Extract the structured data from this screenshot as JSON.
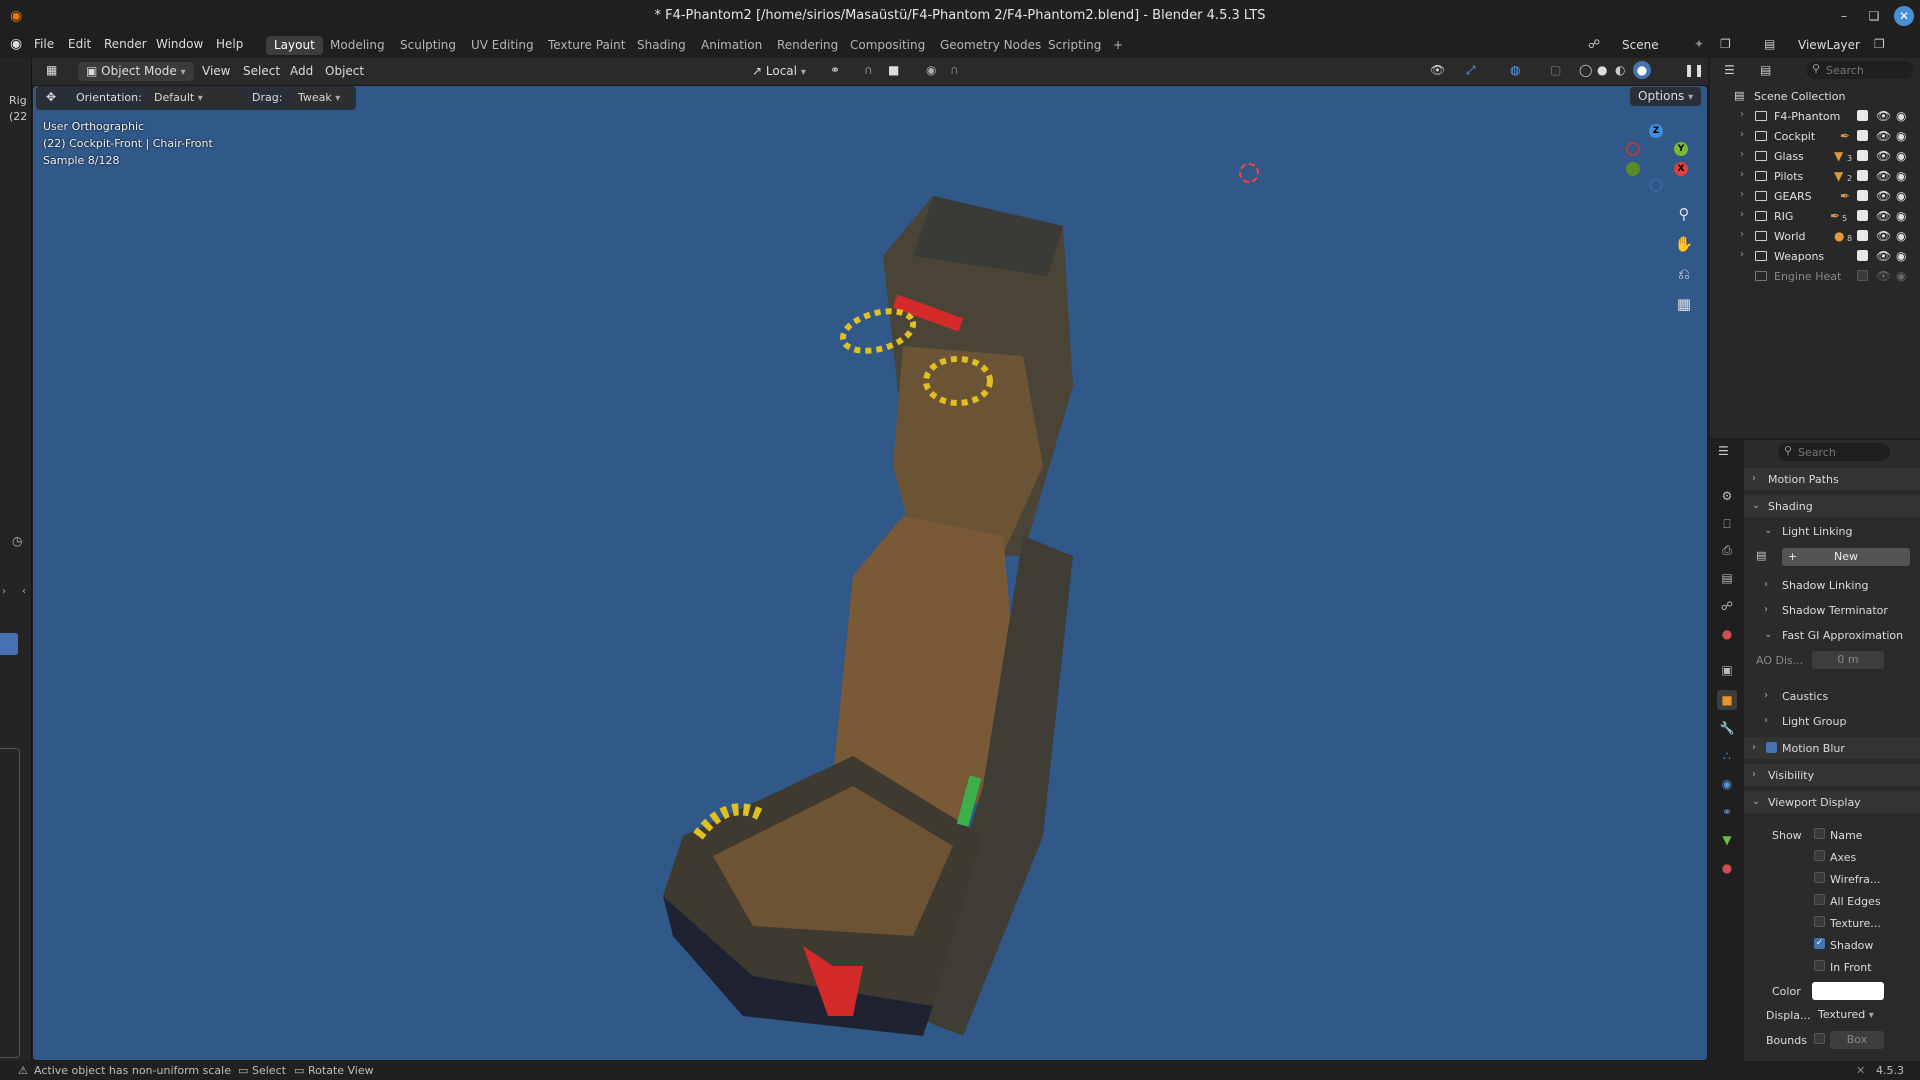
{
  "window": {
    "title": "* F4-Phantom2 [/home/sirios/Masaüstü/F4-Phantom 2/F4-Phantom2.blend] - Blender 4.5.3 LTS",
    "controls": [
      "minimize-icon",
      "maximize-icon",
      "close-icon"
    ]
  },
  "menu": {
    "items": [
      "File",
      "Edit",
      "Render",
      "Window",
      "Help"
    ]
  },
  "workspaces": {
    "tabs": [
      "Layout",
      "Modeling",
      "Sculpting",
      "UV Editing",
      "Texture Paint",
      "Shading",
      "Animation",
      "Rendering",
      "Compositing",
      "Geometry Nodes",
      "Scripting"
    ],
    "active": "Layout",
    "add_label": "+"
  },
  "scene": {
    "label": "Scene",
    "view_layer": "ViewLayer"
  },
  "viewport_header": {
    "mode": "Object Mode",
    "menus": [
      "View",
      "Select",
      "Add",
      "Object"
    ],
    "transform_orientation": "Local",
    "options_label": "Options"
  },
  "tool_settings": {
    "orientation_label": "Orientation:",
    "orientation_value": "Default",
    "drag_label": "Drag:",
    "drag_value": "Tweak"
  },
  "viewport_overlay": {
    "view_name": "User Orthographic",
    "object_info": "(22) Cockpit-Front | Chair-Front",
    "sample": "Sample 8/128"
  },
  "left_panel_fragments": {
    "text1": "Rig",
    "text2": "(22"
  },
  "gizmo": {
    "axes": [
      "Z",
      "Y",
      "X"
    ]
  },
  "outliner": {
    "search_placeholder": "Search",
    "root": "Scene Collection",
    "collections": [
      {
        "name": "F4-Phantom",
        "visible": true,
        "checked": true
      },
      {
        "name": "Cockpit",
        "visible": true,
        "checked": true
      },
      {
        "name": "Glass",
        "visible": true,
        "checked": true,
        "badge": "3"
      },
      {
        "name": "Pilots",
        "visible": true,
        "checked": true,
        "badge": "2"
      },
      {
        "name": "GEARS",
        "visible": true,
        "checked": true
      },
      {
        "name": "RIG",
        "visible": true,
        "checked": true,
        "badge": "5"
      },
      {
        "name": "World",
        "visible": true,
        "checked": true,
        "badge": "8"
      },
      {
        "name": "Weapons",
        "visible": true,
        "checked": true
      },
      {
        "name": "Engine Heat",
        "visible": false,
        "checked": false
      }
    ]
  },
  "properties": {
    "search_placeholder": "Search",
    "motion_paths": "Motion Paths",
    "shading": "Shading",
    "light_linking": "Light Linking",
    "new_label": "New",
    "shadow_linking": "Shadow Linking",
    "shadow_terminator": "Shadow Terminator",
    "fast_gi": "Fast GI Approximation",
    "ao_label": "AO Dis...",
    "ao_value": "0 m",
    "caustics": "Caustics",
    "light_group": "Light Group",
    "motion_blur": "Motion Blur",
    "visibility": "Visibility",
    "viewport_display": "Viewport Display",
    "show_label": "Show",
    "show_options": [
      {
        "label": "Name",
        "checked": false
      },
      {
        "label": "Axes",
        "checked": false
      },
      {
        "label": "Wirefra...",
        "checked": false
      },
      {
        "label": "All Edges",
        "checked": false
      },
      {
        "label": "Texture...",
        "checked": false
      },
      {
        "label": "Shadow",
        "checked": true
      },
      {
        "label": "In Front",
        "checked": false
      }
    ],
    "color_label": "Color",
    "color_value": "#ffffff",
    "display_label": "Displa...",
    "display_value": "Textured",
    "bounds_label": "Bounds",
    "bounds_value": "Box"
  },
  "statusbar": {
    "warning": "Active object has non-uniform scale",
    "select": "Select",
    "rotate": "Rotate View",
    "version": "4.5.3"
  }
}
